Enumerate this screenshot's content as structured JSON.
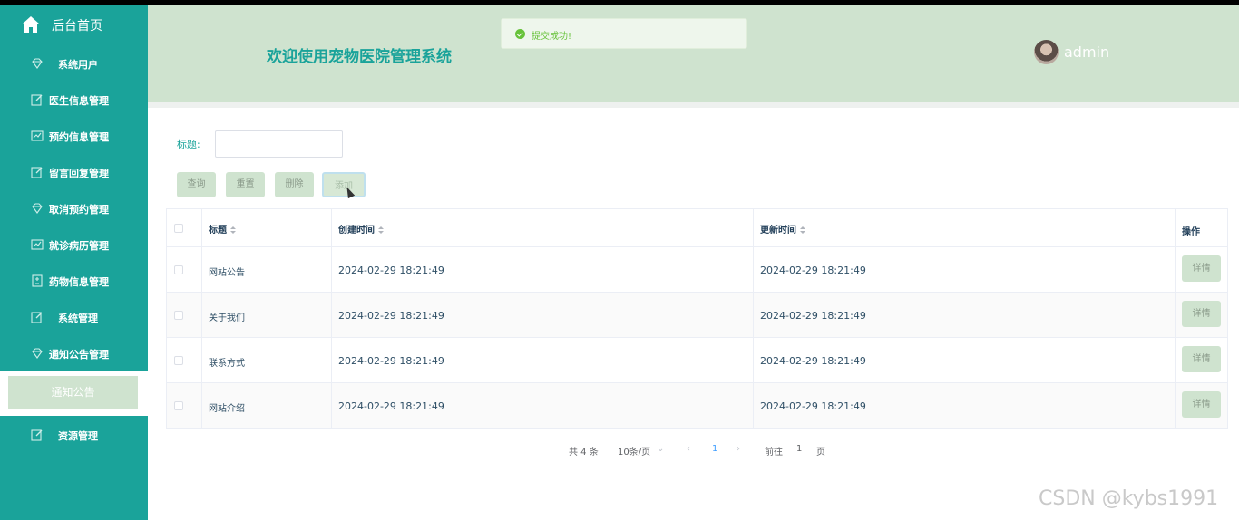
{
  "sidebar": {
    "home_label": "后台首页",
    "items": [
      {
        "label": "系统用户",
        "icon": "gem-icon"
      },
      {
        "label": "医生信息管理",
        "icon": "edit-icon"
      },
      {
        "label": "预约信息管理",
        "icon": "chart-icon"
      },
      {
        "label": "留言回复管理",
        "icon": "edit-icon"
      },
      {
        "label": "取消预约管理",
        "icon": "gem-icon"
      },
      {
        "label": "就诊病历管理",
        "icon": "chart-icon"
      },
      {
        "label": "药物信息管理",
        "icon": "document-icon"
      },
      {
        "label": "系统管理",
        "icon": "edit-icon"
      },
      {
        "label": "通知公告管理",
        "icon": "gem-icon"
      },
      {
        "label": "资源管理",
        "icon": "edit-icon"
      }
    ],
    "active_sub_item": "通知公告"
  },
  "header": {
    "title": "欢迎使用宠物医院管理系统",
    "toast": "提交成功!",
    "username": "admin"
  },
  "search": {
    "label": "标题:",
    "value": "",
    "buttons": {
      "query": "查询",
      "reset": "重置",
      "delete": "删除",
      "add": "添加"
    }
  },
  "table": {
    "columns": {
      "title": "标题",
      "created": "创建时间",
      "updated": "更新时间",
      "action": "操作"
    },
    "rows": [
      {
        "title": "网站公告",
        "created": "2024-02-29 18:21:49",
        "updated": "2024-02-29 18:21:49",
        "action": "详情"
      },
      {
        "title": "关于我们",
        "created": "2024-02-29 18:21:49",
        "updated": "2024-02-29 18:21:49",
        "action": "详情"
      },
      {
        "title": "联系方式",
        "created": "2024-02-29 18:21:49",
        "updated": "2024-02-29 18:21:49",
        "action": "详情"
      },
      {
        "title": "网站介绍",
        "created": "2024-02-29 18:21:49",
        "updated": "2024-02-29 18:21:49",
        "action": "详情"
      }
    ]
  },
  "pagination": {
    "total": "共 4 条",
    "page_size": "10条/页",
    "current_page": "1",
    "goto_label": "前往",
    "goto_value": "1",
    "page_unit": "页"
  },
  "watermark": "CSDN @kybs1991",
  "colors": {
    "accent": "#1aa39a",
    "header_bg": "#cfe3cf",
    "success": "#67c23a"
  }
}
